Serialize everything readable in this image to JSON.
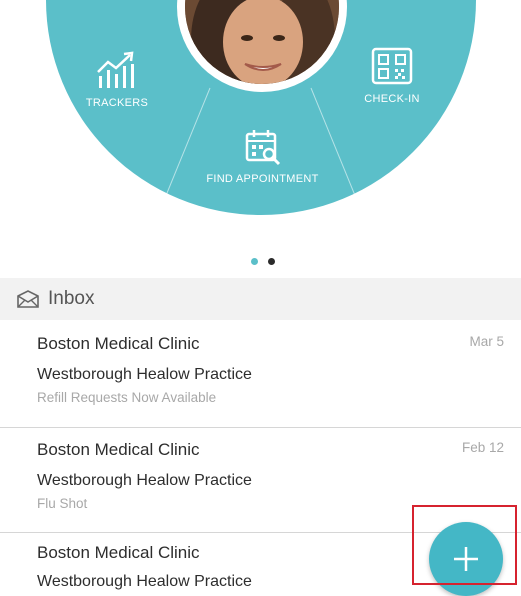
{
  "colors": {
    "menu_teal": "#5bbfc9",
    "fab_teal": "#44b7c6",
    "highlight_red": "#d6232f"
  },
  "radial_menu": {
    "items": [
      {
        "label": "TRACKERS",
        "icon": "trend-chart-icon"
      },
      {
        "label": "CHECK-IN",
        "icon": "qr-code-icon"
      },
      {
        "label": "FIND APPOINTMENT",
        "icon": "calendar-search-icon"
      }
    ],
    "profile_photo": "profile-avatar"
  },
  "pager": {
    "pages": 2,
    "active_index": 0
  },
  "inbox": {
    "title": "Inbox",
    "icon": "envelope-icon",
    "messages": [
      {
        "sender": "Boston Medical Clinic",
        "practice": "Westborough Healow Practice",
        "subject": "Refill Requests Now Available",
        "date": "Mar 5"
      },
      {
        "sender": "Boston Medical Clinic",
        "practice": "Westborough Healow Practice",
        "subject": "Flu Shot",
        "date": "Feb 12"
      },
      {
        "sender": "Boston Medical Clinic",
        "practice": "Westborough Healow Practice",
        "subject": "",
        "date": ""
      }
    ]
  },
  "fab": {
    "icon": "plus-icon"
  }
}
